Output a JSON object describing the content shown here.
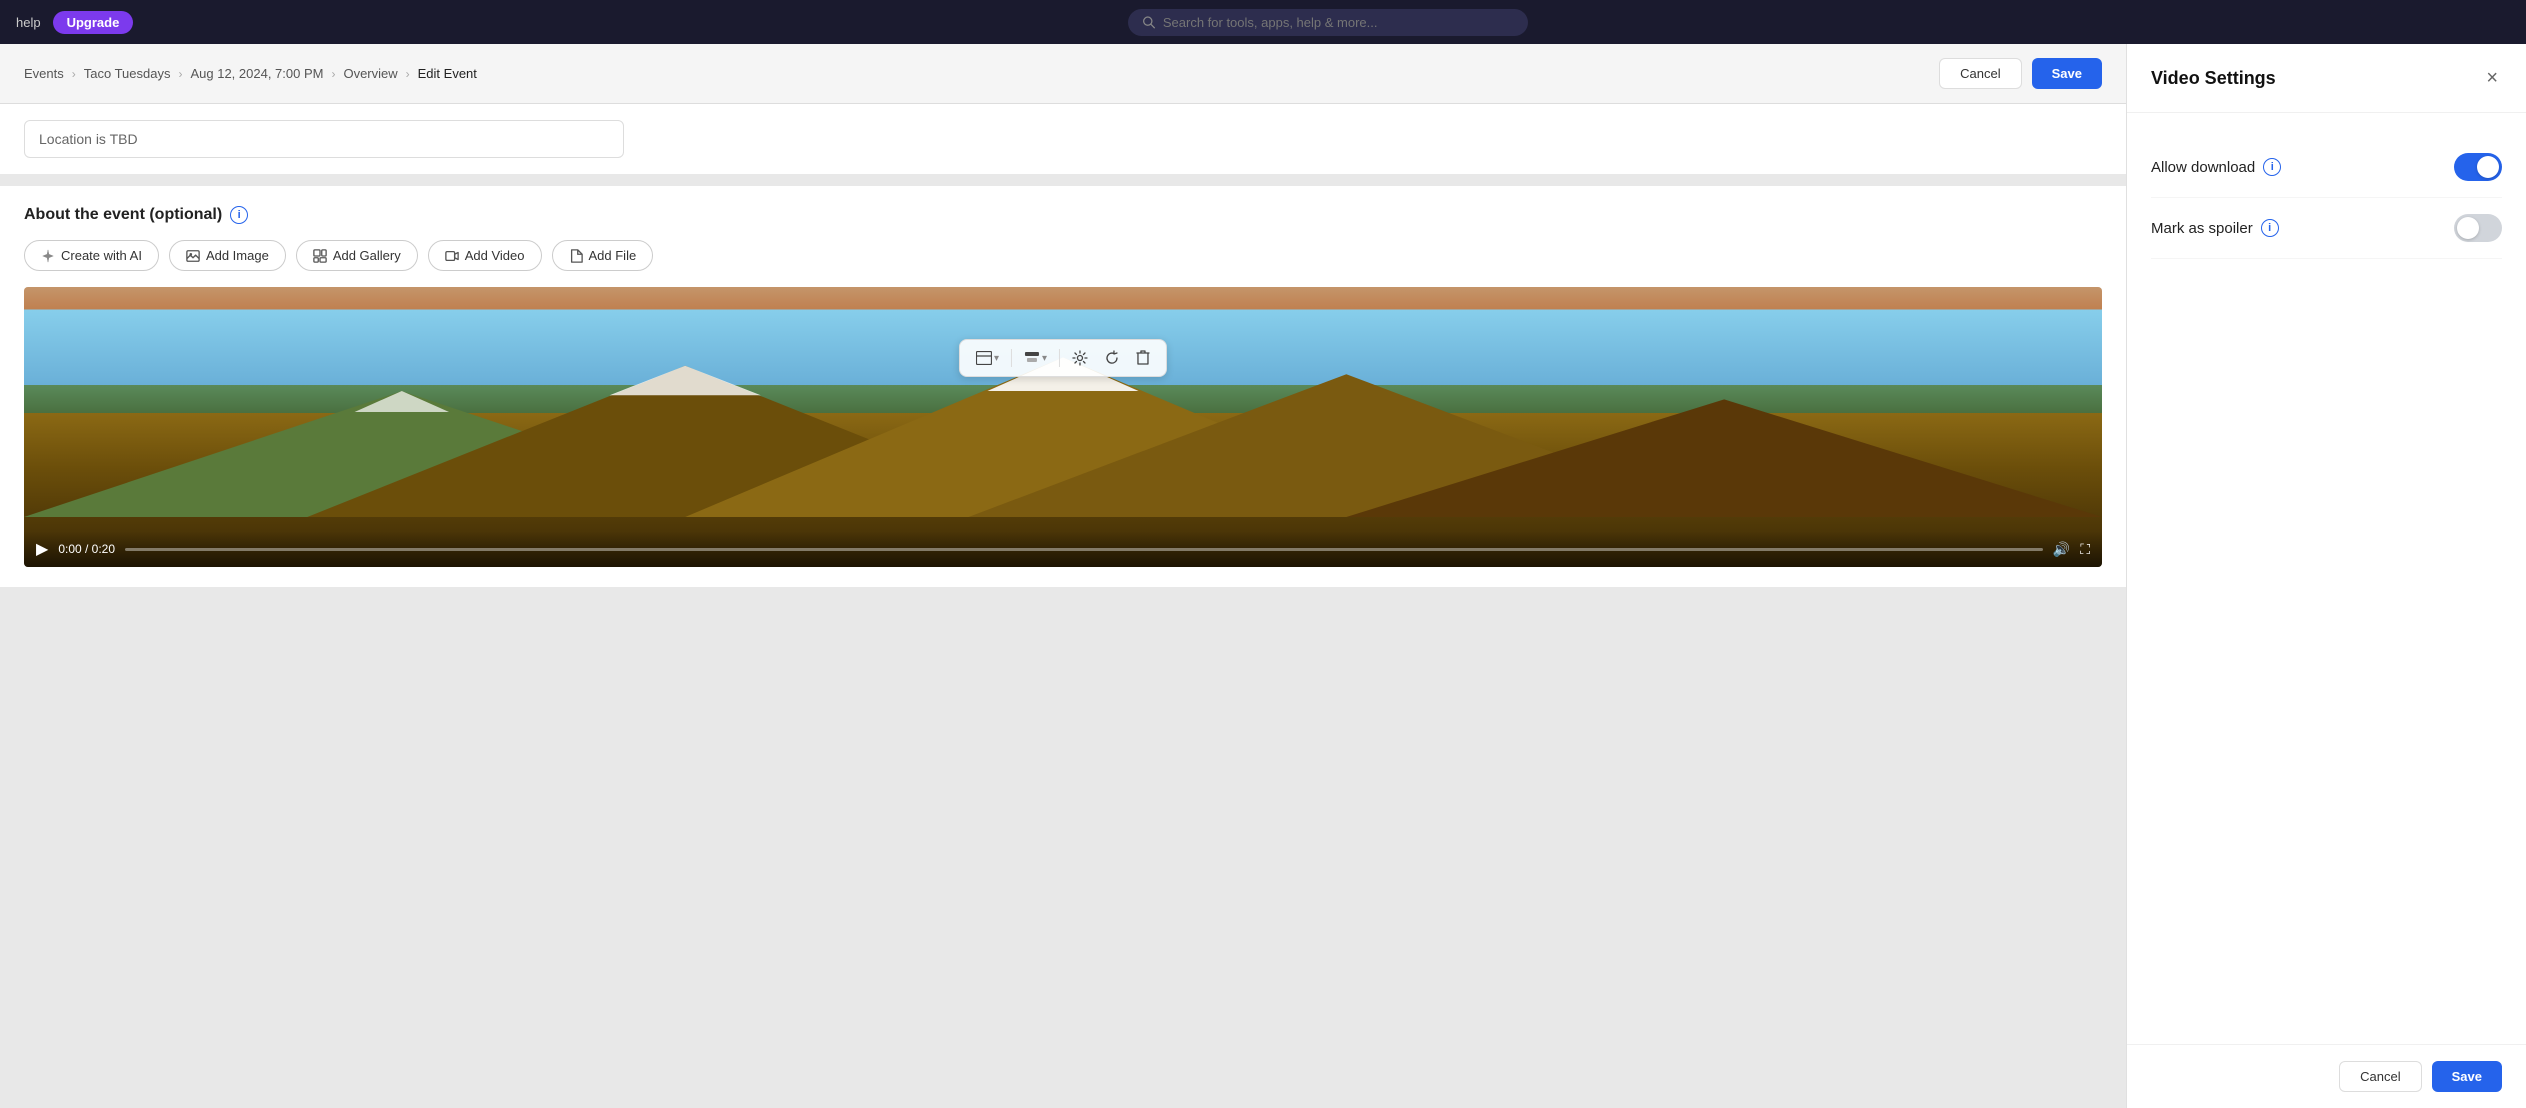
{
  "nav": {
    "help_label": "help",
    "upgrade_label": "Upgrade",
    "search_placeholder": "Search for tools, apps, help & more..."
  },
  "breadcrumb": {
    "items": [
      "Events",
      "Taco Tuesdays",
      "Aug 12, 2024, 7:00 PM",
      "Overview",
      "Edit Event"
    ]
  },
  "header_buttons": {
    "cancel_label": "Cancel",
    "save_label": "Save"
  },
  "location": {
    "value": "Location is TBD"
  },
  "about_section": {
    "title": "About the event (optional)"
  },
  "content_toolbar": {
    "create_ai_label": "Create with AI",
    "add_image_label": "Add Image",
    "add_gallery_label": "Add Gallery",
    "add_video_label": "Add Video",
    "add_file_label": "Add File"
  },
  "video": {
    "time": "0:00 / 0:20"
  },
  "settings_panel": {
    "title": "Video Settings",
    "close_icon": "×",
    "allow_download_label": "Allow download",
    "mark_as_spoiler_label": "Mark as spoiler",
    "allow_download_on": true,
    "mark_as_spoiler_on": false,
    "cancel_label": "Cancel",
    "save_label": "Save"
  }
}
